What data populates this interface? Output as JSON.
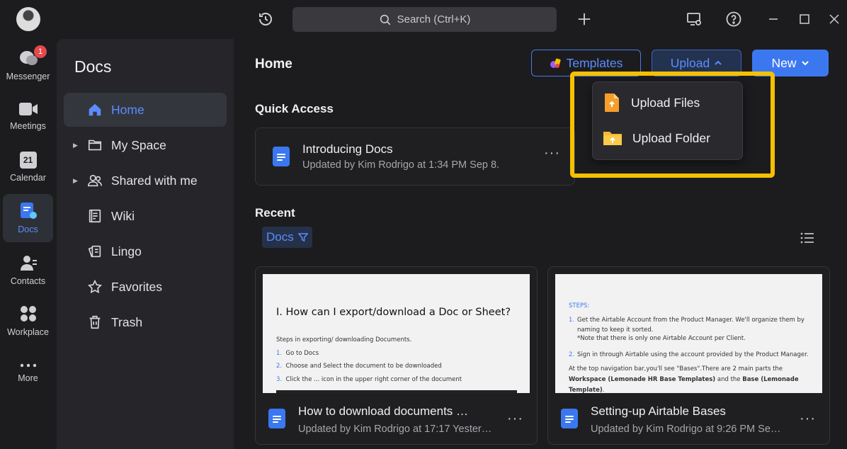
{
  "titlebar": {
    "search_label": "Search (Ctrl+K)",
    "icons": [
      "history-icon",
      "search-icon",
      "plus-icon",
      "screen-share-icon",
      "help-icon",
      "minimize-icon",
      "maximize-icon",
      "close-icon"
    ]
  },
  "rail": {
    "items": [
      {
        "label": "Messenger",
        "badge": "1",
        "icon": "chat-icon"
      },
      {
        "label": "Meetings",
        "icon": "video-icon"
      },
      {
        "label": "Calendar",
        "icon": "calendar-icon",
        "day": "21"
      },
      {
        "label": "Docs",
        "icon": "docs-icon",
        "active": true
      },
      {
        "label": "Contacts",
        "icon": "contacts-icon"
      },
      {
        "label": "Workplace",
        "icon": "apps-icon"
      },
      {
        "label": "More",
        "icon": "more-icon"
      }
    ]
  },
  "sidebar": {
    "title": "Docs",
    "items": [
      {
        "label": "Home",
        "icon": "home-icon",
        "active": true
      },
      {
        "label": "My Space",
        "icon": "folder-icon",
        "expandable": true
      },
      {
        "label": "Shared with me",
        "icon": "people-icon",
        "expandable": true
      },
      {
        "label": "Wiki",
        "icon": "wiki-icon"
      },
      {
        "label": "Lingo",
        "icon": "lingo-icon"
      },
      {
        "label": "Favorites",
        "icon": "star-icon"
      },
      {
        "label": "Trash",
        "icon": "trash-icon"
      }
    ]
  },
  "main": {
    "title": "Home",
    "buttons": {
      "templates": "Templates",
      "upload": "Upload",
      "new": "New"
    },
    "quick_access": {
      "heading": "Quick Access",
      "item": {
        "title": "Introducing Docs",
        "subtitle": "Updated by Kim Rodrigo at 1:34 PM Sep 8."
      }
    },
    "recent": {
      "heading": "Recent",
      "filter": "Docs",
      "cards": [
        {
          "title": "How to download documents …",
          "subtitle": "Updated by Kim Rodrigo at 17:17 Yester…",
          "preview": {
            "heading": "I. How can I export/download a Doc or Sheet?",
            "intro": "Steps in exporting/ downloading Documents.",
            "steps": [
              "Go to Docs",
              "Choose and Select the document to be downloaded",
              "Click the ... icon in the upper right corner of the document"
            ]
          }
        },
        {
          "title": "Setting-up Airtable Bases",
          "subtitle": "Updated by Kim Rodrigo at 9:26 PM Se…",
          "preview": {
            "label": "STEPS:",
            "step1": "Get the Airtable Account from the Product Manager. We'll organize them by naming to keep it sorted.",
            "note": "*Note that there is only one Airtable Account per Client.",
            "step2": "Sign in through Airtable using the account provided by the Product Manager.",
            "para_a": "At the top navigation bar,you'll see \"Bases\".There are 2 main parts the ",
            "para_b": "Workspace (Lemonade HR Base Templates)",
            "para_c": " and the ",
            "para_d": "Base (Lemonade Template)",
            "para_e": "."
          }
        }
      ]
    }
  },
  "upload_menu": {
    "items": [
      {
        "label": "Upload Files",
        "icon": "upload-file-icon"
      },
      {
        "label": "Upload Folder",
        "icon": "upload-folder-icon"
      }
    ]
  },
  "colors": {
    "accent": "#3b78f0",
    "highlight": "#f5c000",
    "badge": "#e5484d"
  }
}
